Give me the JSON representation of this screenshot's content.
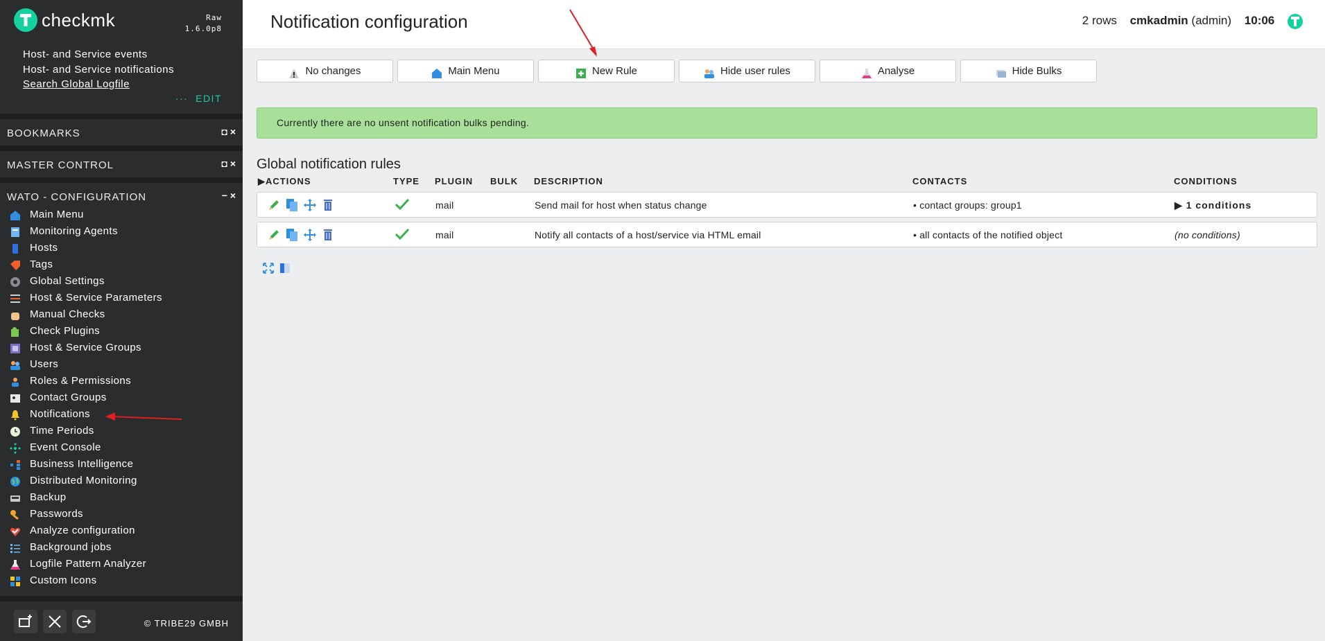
{
  "app": {
    "brand": "checkmk",
    "edition": "Raw",
    "version": "1.6.0p8",
    "accent_color": "#15d1a0"
  },
  "sidebar": {
    "links": [
      "Host- and Service events",
      "Host- and Service notifications",
      "Search Global Logfile"
    ],
    "edit_label": "EDIT",
    "edit_prefix": "···",
    "bookmarks_title": "BOOKMARKS",
    "master_control_title": "MASTER CONTROL",
    "wato_title": "WATO - CONFIGURATION",
    "menu": [
      {
        "label": "Main Menu",
        "icon": "home-icon"
      },
      {
        "label": "Monitoring Agents",
        "icon": "agents-icon"
      },
      {
        "label": "Hosts",
        "icon": "hosts-icon"
      },
      {
        "label": "Tags",
        "icon": "tags-icon"
      },
      {
        "label": "Global Settings",
        "icon": "gear-icon"
      },
      {
        "label": "Host & Service Parameters",
        "icon": "parameters-icon"
      },
      {
        "label": "Manual Checks",
        "icon": "hand-icon"
      },
      {
        "label": "Check Plugins",
        "icon": "puzzle-icon"
      },
      {
        "label": "Host & Service Groups",
        "icon": "groups-icon"
      },
      {
        "label": "Users",
        "icon": "users-icon"
      },
      {
        "label": "Roles & Permissions",
        "icon": "roles-icon"
      },
      {
        "label": "Contact Groups",
        "icon": "contact-groups-icon"
      },
      {
        "label": "Notifications",
        "icon": "bell-icon"
      },
      {
        "label": "Time Periods",
        "icon": "clock-icon"
      },
      {
        "label": "Event Console",
        "icon": "event-console-icon"
      },
      {
        "label": "Business Intelligence",
        "icon": "bi-icon"
      },
      {
        "label": "Distributed Monitoring",
        "icon": "globe-icon"
      },
      {
        "label": "Backup",
        "icon": "backup-icon"
      },
      {
        "label": "Passwords",
        "icon": "key-icon"
      },
      {
        "label": "Analyze configuration",
        "icon": "analyze-icon"
      },
      {
        "label": "Background jobs",
        "icon": "jobs-icon"
      },
      {
        "label": "Logfile Pattern Analyzer",
        "icon": "flask-icon"
      },
      {
        "label": "Custom Icons",
        "icon": "custom-icons-icon"
      }
    ],
    "copyright": "© TRIBE29 GMBH"
  },
  "header": {
    "title": "Notification configuration",
    "rows": "2 rows",
    "user_name": "cmkadmin",
    "user_role": "(admin)",
    "time": "10:06"
  },
  "toolbar": {
    "no_changes": "No changes",
    "main_menu": "Main Menu",
    "new_rule": "New Rule",
    "hide_user_rules": "Hide user rules",
    "analyse": "Analyse",
    "hide_bulks": "Hide Bulks"
  },
  "info": {
    "message": "Currently there are no unsent notification bulks pending."
  },
  "rules": {
    "title": "Global notification rules",
    "columns": {
      "actions": "ACTIONS",
      "type": "TYPE",
      "plugin": "PLUGIN",
      "bulk": "BULK",
      "description": "DESCRIPTION",
      "contacts": "CONTACTS",
      "conditions": "CONDITIONS"
    },
    "rows": [
      {
        "plugin": "mail",
        "bulk": "",
        "description": "Send mail for host when status change",
        "contacts": "• contact groups: group1",
        "conditions": "1 conditions"
      },
      {
        "plugin": "mail",
        "bulk": "",
        "description": "Notify all contacts of a host/service via HTML email",
        "contacts": "• all contacts of the notified object",
        "conditions": "(no conditions)"
      }
    ]
  }
}
